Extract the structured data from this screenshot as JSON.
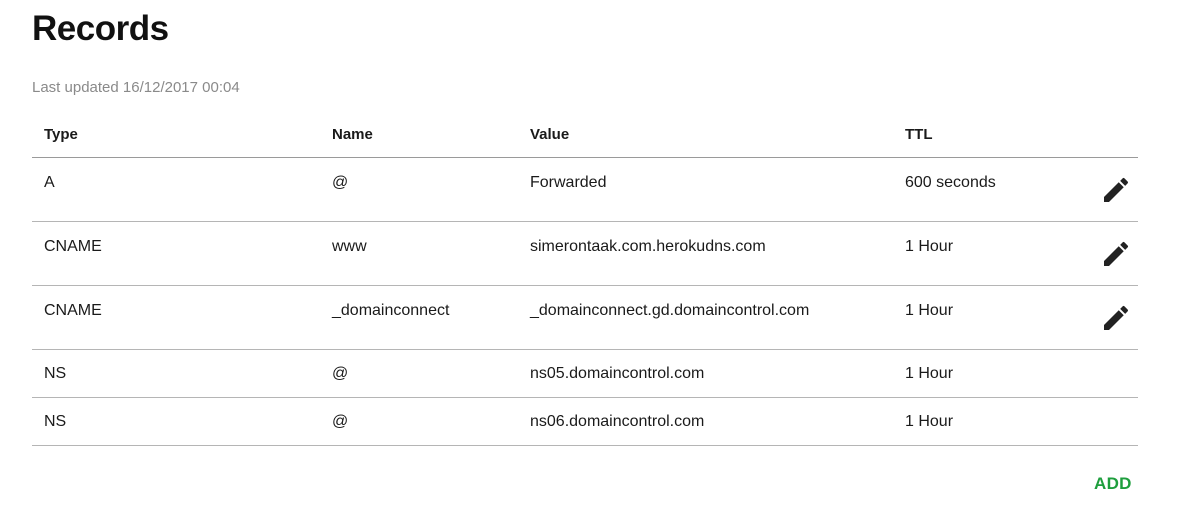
{
  "header": {
    "title": "Records",
    "last_updated": "Last updated 16/12/2017 00:04"
  },
  "table": {
    "columns": [
      "Type",
      "Name",
      "Value",
      "TTL"
    ],
    "rows": [
      {
        "type": "A",
        "name": "@",
        "value": "Forwarded",
        "ttl": "600 seconds",
        "editable": true
      },
      {
        "type": "CNAME",
        "name": "www",
        "value": "simerontaak.com.herokudns.com",
        "ttl": "1 Hour",
        "editable": true
      },
      {
        "type": "CNAME",
        "name": "_domainconnect",
        "value": "_domainconnect.gd.domaincontrol.com",
        "ttl": "1 Hour",
        "editable": true
      },
      {
        "type": "NS",
        "name": "@",
        "value": "ns05.domaincontrol.com",
        "ttl": "1 Hour",
        "editable": false
      },
      {
        "type": "NS",
        "name": "@",
        "value": "ns06.domaincontrol.com",
        "ttl": "1 Hour",
        "editable": false
      }
    ]
  },
  "actions": {
    "add_label": "ADD"
  },
  "colors": {
    "accent": "#1e9e3d",
    "muted_text": "#8a8a8a",
    "divider": "#b5b5b5",
    "icon": "#222222"
  },
  "icons": {
    "edit": "pencil-icon"
  }
}
